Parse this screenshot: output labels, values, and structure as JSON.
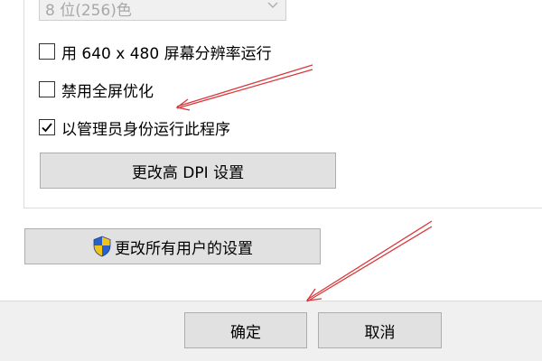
{
  "compat": {
    "color_mode_value": "8 位(256)色",
    "options": [
      {
        "label": "用 640 x 480 屏幕分辨率运行",
        "checked": false
      },
      {
        "label": "禁用全屏优化",
        "checked": false
      },
      {
        "label": "以管理员身份运行此程序",
        "checked": true
      }
    ],
    "dpi_button_label": "更改高 DPI 设置"
  },
  "all_users_button_label": "更改所有用户的设置",
  "footer": {
    "ok_label": "确定",
    "cancel_label": "取消"
  },
  "icons": {
    "dropdown": "chevron-down-icon",
    "checkbox": "check-icon",
    "all_users": "uac-shield-icon"
  },
  "colors": {
    "annotation_arrow": "#d9383a",
    "button_face": "#e1e1e1",
    "button_border": "#adadad",
    "window_background": "#f0f0f0"
  }
}
